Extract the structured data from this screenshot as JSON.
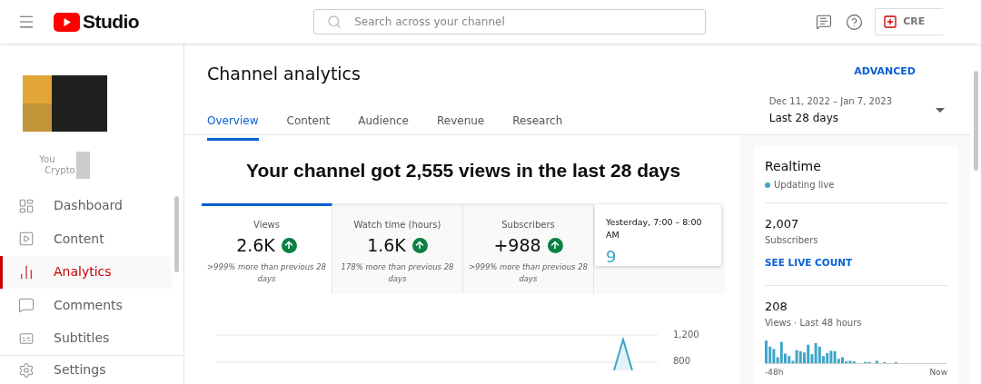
{
  "header": {
    "logo_text": "Studio",
    "search": {
      "placeholder": "Search across your channel"
    },
    "create_button": "CRE"
  },
  "sidebar": {
    "channel_name": "You",
    "channel_sub": "Crypto",
    "items": [
      {
        "label": "Dashboard",
        "selected": false
      },
      {
        "label": "Content",
        "selected": false
      },
      {
        "label": "Analytics",
        "selected": true
      },
      {
        "label": "Comments",
        "selected": false
      },
      {
        "label": "Subtitles",
        "selected": false
      }
    ],
    "footer_item": {
      "label": "Settings"
    }
  },
  "page": {
    "title": "Channel analytics",
    "advanced_mode": "ADVANCED",
    "tabs": [
      {
        "label": "Overview",
        "selected": true
      },
      {
        "label": "Content",
        "selected": false
      },
      {
        "label": "Audience",
        "selected": false
      },
      {
        "label": "Revenue",
        "selected": false
      },
      {
        "label": "Research",
        "selected": false
      }
    ],
    "date_range": {
      "range": "Dec 11, 2022 – Jan 7, 2023",
      "label": "Last 28 days"
    }
  },
  "summary": {
    "headline": "Your channel got 2,555 views in the last 28 days"
  },
  "metrics": [
    {
      "title": "Views",
      "value": "2.6K",
      "note": ">999% more than previous 28 days",
      "selected": true
    },
    {
      "title": "Watch time (hours)",
      "value": "1.6K",
      "note": "178% more than previous 28 days",
      "selected": false
    },
    {
      "title": "Subscribers",
      "value": "+988",
      "note": ">999% more than previous 28 days",
      "selected": false
    }
  ],
  "hover_card": {
    "title": "Yesterday, 7:00 – 8:00 AM",
    "value": "9"
  },
  "chart_axis_labels": [
    "1,200",
    "800"
  ],
  "realtime": {
    "title": "Realtime",
    "status": "Updating live",
    "subscribers": {
      "value": "2,007",
      "label": "Subscribers",
      "link": "SEE LIVE COUNT"
    },
    "views": {
      "value": "208",
      "label": "Views · Last 48 hours",
      "axis_start": "-48h",
      "axis_end": "Now"
    }
  }
}
